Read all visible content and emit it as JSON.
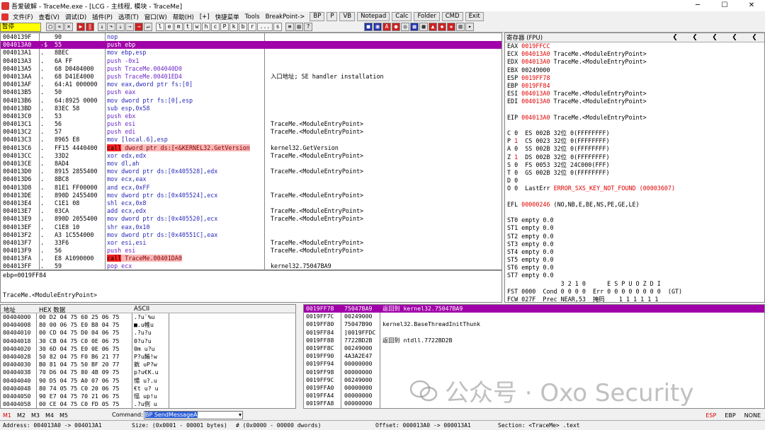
{
  "window": {
    "title": "吾爱破解 - TraceMe.exe - [LCG - 主线程, 模块 - TraceMe]"
  },
  "menu": {
    "items": [
      "文件(F)",
      "查看(V)",
      "调试(D)",
      "插件(P)",
      "选项(T)",
      "窗口(W)",
      "帮助(H)",
      "[+]",
      "快捷菜单",
      "Tools",
      "BreakPoint->"
    ],
    "buttons": [
      "BP",
      "P",
      "VB",
      "Notepad",
      "Calc",
      "Folder",
      "CMD",
      "Exit"
    ]
  },
  "toolbar": {
    "status": "暂停",
    "letters": [
      "l",
      "e",
      "m",
      "t",
      "w",
      "h",
      "c",
      "P",
      "k",
      "b",
      "r",
      "...",
      "s"
    ]
  },
  "cpu": {
    "rows": [
      {
        "addr": "0040139F",
        "mark": "",
        "hex": "90",
        "asm": "nop",
        "mn": "def",
        "cmt": ""
      },
      {
        "addr": "004013A0",
        "mark": "-$",
        "hex": "55",
        "asm": "push ebp",
        "mn": "push",
        "cmt": "",
        "sel": true
      },
      {
        "addr": "004013A1",
        "mark": ".",
        "hex": "8BEC",
        "asm": "mov ebp,esp",
        "mn": "def",
        "cmt": ""
      },
      {
        "addr": "004013A3",
        "mark": ".",
        "hex": "6A FF",
        "asm": "push -0x1",
        "mn": "push",
        "cmt": ""
      },
      {
        "addr": "004013A5",
        "mark": ".",
        "hex": "68 D0404000",
        "asm": "push TraceMe.004040D0",
        "mn": "push",
        "cmt": ""
      },
      {
        "addr": "004013AA",
        "mark": ".",
        "hex": "68 D41E4000",
        "asm": "push TraceMe.00401ED4",
        "mn": "push",
        "cmt": "入口地址; SE handler installation"
      },
      {
        "addr": "004013AF",
        "mark": ".",
        "hex": "64:A1 000000",
        "asm": "mov eax,dword ptr fs:[0]",
        "mn": "def",
        "cmt": ""
      },
      {
        "addr": "004013B5",
        "mark": ".",
        "hex": "50",
        "asm": "push eax",
        "mn": "push",
        "cmt": ""
      },
      {
        "addr": "004013B6",
        "mark": ".",
        "hex": "64:8925 0000",
        "asm": "mov dword ptr fs:[0],esp",
        "mn": "def",
        "cmt": ""
      },
      {
        "addr": "004013BD",
        "mark": ".",
        "hex": "83EC 58",
        "asm": "sub esp,0x58",
        "mn": "def",
        "cmt": ""
      },
      {
        "addr": "004013C0",
        "mark": ".",
        "hex": "53",
        "asm": "push ebx",
        "mn": "push",
        "cmt": ""
      },
      {
        "addr": "004013C1",
        "mark": ".",
        "hex": "56",
        "asm": "push esi",
        "mn": "push",
        "cmt": "TraceMe.<ModuleEntryPoint>"
      },
      {
        "addr": "004013C2",
        "mark": ".",
        "hex": "57",
        "asm": "push edi",
        "mn": "push",
        "cmt": "TraceMe.<ModuleEntryPoint>"
      },
      {
        "addr": "004013C3",
        "mark": ".",
        "hex": "8965 E8",
        "asm": "mov [local.6],esp",
        "mn": "def",
        "cmt": ""
      },
      {
        "addr": "004013C6",
        "mark": ".",
        "hex": "FF15 4440400",
        "asm": "call dword ptr ds:[<&KERNEL32.GetVersion",
        "mn": "call",
        "cmt": "kernel32.GetVersion"
      },
      {
        "addr": "004013CC",
        "mark": ".",
        "hex": "33D2",
        "asm": "xor edx,edx",
        "mn": "def",
        "cmt": "TraceMe.<ModuleEntryPoint>"
      },
      {
        "addr": "004013CE",
        "mark": ".",
        "hex": "8AD4",
        "asm": "mov dl,ah",
        "mn": "def",
        "cmt": ""
      },
      {
        "addr": "004013D0",
        "mark": ".",
        "hex": "8915 2855400",
        "asm": "mov dword ptr ds:[0x405528],edx",
        "mn": "def",
        "cmt": "TraceMe.<ModuleEntryPoint>"
      },
      {
        "addr": "004013D6",
        "mark": ".",
        "hex": "8BC8",
        "asm": "mov ecx,eax",
        "mn": "def",
        "cmt": ""
      },
      {
        "addr": "004013D8",
        "mark": ".",
        "hex": "81E1 FF00000",
        "asm": "and ecx,0xFF",
        "mn": "def",
        "cmt": ""
      },
      {
        "addr": "004013DE",
        "mark": ".",
        "hex": "890D 2455400",
        "asm": "mov dword ptr ds:[0x405524],ecx",
        "mn": "def",
        "cmt": "TraceMe.<ModuleEntryPoint>"
      },
      {
        "addr": "004013E4",
        "mark": ".",
        "hex": "C1E1 08",
        "asm": "shl ecx,0x8",
        "mn": "def",
        "cmt": ""
      },
      {
        "addr": "004013E7",
        "mark": ".",
        "hex": "03CA",
        "asm": "add ecx,edx",
        "mn": "def",
        "cmt": "TraceMe.<ModuleEntryPoint>"
      },
      {
        "addr": "004013E9",
        "mark": ".",
        "hex": "890D 2055400",
        "asm": "mov dword ptr ds:[0x405520],ecx",
        "mn": "def",
        "cmt": "TraceMe.<ModuleEntryPoint>"
      },
      {
        "addr": "004013EF",
        "mark": ".",
        "hex": "C1E8 10",
        "asm": "shr eax,0x10",
        "mn": "def",
        "cmt": ""
      },
      {
        "addr": "004013F2",
        "mark": ".",
        "hex": "A3 1C554000",
        "asm": "mov dword ptr ds:[0x40551C],eax",
        "mn": "def",
        "cmt": ""
      },
      {
        "addr": "004013F7",
        "mark": ".",
        "hex": "33F6",
        "asm": "xor esi,esi",
        "mn": "def",
        "cmt": "TraceMe.<ModuleEntryPoint>"
      },
      {
        "addr": "004013F9",
        "mark": ".",
        "hex": "56",
        "asm": "push esi",
        "mn": "push",
        "cmt": "TraceMe.<ModuleEntryPoint>"
      },
      {
        "addr": "004013FA",
        "mark": ".",
        "hex": "E8 A1090000",
        "asm": "call TraceMe.00401DA0",
        "mn": "call",
        "cmt": ""
      },
      {
        "addr": "004013FF",
        "mark": ".",
        "hex": "59",
        "asm": "pop ecx",
        "mn": "push",
        "cmt": "kernel32.75047BA9"
      }
    ]
  },
  "info": {
    "line1": "ebp=0019FF84",
    "line2": "TraceMe.<ModuleEntryPoint>"
  },
  "registers": {
    "header": "寄存器 (FPU)",
    "lines": [
      {
        "t": "EAX ",
        "v": "0019FFCC",
        "c": "",
        "red": true
      },
      {
        "t": "ECX ",
        "v": "004013A0",
        "c": " TraceMe.<ModuleEntryPoint>",
        "red": true
      },
      {
        "t": "EDX ",
        "v": "004013A0",
        "c": " TraceMe.<ModuleEntryPoint>",
        "red": true
      },
      {
        "t": "EBX ",
        "v": "00249000",
        "c": "",
        "red": false
      },
      {
        "t": "ESP ",
        "v": "0019FF78",
        "c": "",
        "red": true
      },
      {
        "t": "EBP ",
        "v": "0019FF84",
        "c": "",
        "red": true
      },
      {
        "t": "ESI ",
        "v": "004013A0",
        "c": " TraceMe.<ModuleEntryPoint>",
        "red": true
      },
      {
        "t": "EDI ",
        "v": "004013A0",
        "c": " TraceMe.<ModuleEntryPoint>",
        "red": true
      },
      {
        "t": "",
        "v": "",
        "c": "",
        "red": false
      },
      {
        "t": "EIP ",
        "v": "004013A0",
        "c": " TraceMe.<ModuleEntryPoint>",
        "red": true
      },
      {
        "t": "",
        "v": "",
        "c": "",
        "red": false
      },
      {
        "t": "C 0  ",
        "v": "",
        "c": "ES 002B 32位 0(FFFFFFFF)",
        "red": false
      },
      {
        "t": "P ",
        "v": "1",
        "c": "  CS 0023 32位 0(FFFFFFFF)",
        "red": true
      },
      {
        "t": "A 0  ",
        "v": "",
        "c": "SS 002B 32位 0(FFFFFFFF)",
        "red": false
      },
      {
        "t": "Z ",
        "v": "1",
        "c": "  DS 002B 32位 0(FFFFFFFF)",
        "red": true
      },
      {
        "t": "S 0  ",
        "v": "",
        "c": "FS 0053 32位 24C000(FFF)",
        "red": false
      },
      {
        "t": "T 0  ",
        "v": "",
        "c": "GS 002B 32位 0(FFFFFFFF)",
        "red": false
      },
      {
        "t": "D 0",
        "v": "",
        "c": "",
        "red": false
      },
      {
        "t": "O 0  LastErr ",
        "v": "ERROR_SXS_KEY_NOT_FOUND (00003607)",
        "c": "",
        "red": true
      },
      {
        "t": "",
        "v": "",
        "c": "",
        "red": false
      },
      {
        "t": "EFL ",
        "v": "00000246",
        "c": " (NO,NB,E,BE,NS,PE,GE,LE)",
        "red": true
      },
      {
        "t": "",
        "v": "",
        "c": "",
        "red": false
      },
      {
        "t": "ST0 empty 0.0",
        "v": "",
        "c": "",
        "red": false
      },
      {
        "t": "ST1 empty 0.0",
        "v": "",
        "c": "",
        "red": false
      },
      {
        "t": "ST2 empty 0.0",
        "v": "",
        "c": "",
        "red": false
      },
      {
        "t": "ST3 empty 0.0",
        "v": "",
        "c": "",
        "red": false
      },
      {
        "t": "ST4 empty 0.0",
        "v": "",
        "c": "",
        "red": false
      },
      {
        "t": "ST5 empty 0.0",
        "v": "",
        "c": "",
        "red": false
      },
      {
        "t": "ST6 empty 0.0",
        "v": "",
        "c": "",
        "red": false
      },
      {
        "t": "ST7 empty 0.0",
        "v": "",
        "c": "",
        "red": false
      },
      {
        "t": "               3 2 1 0      E S P U O Z D I",
        "v": "",
        "c": "",
        "red": false
      },
      {
        "t": "FST 0000  Cond 0 0 0 0  Err 0 0 0 0 0 0 0 0  (GT)",
        "v": "",
        "c": "",
        "red": false
      },
      {
        "t": "FCW 027F  Prec NEAR,53  掩码    1 1 1 1 1 1",
        "v": "",
        "c": "",
        "red": false
      }
    ]
  },
  "dump": {
    "headers": [
      "地址",
      "HEX 数据",
      "ASCII"
    ],
    "rows": [
      {
        "addr": "00404000",
        "hex": "00 D2 04 75 60 25 06 75",
        "ascii": ".?u`%u"
      },
      {
        "addr": "00404008",
        "hex": "80 00 06 75 E0 B8 04 75",
        "ascii": "■.u帷u"
      },
      {
        "addr": "00404010",
        "hex": "00 CD 04 75 D0 04 06 75",
        "ascii": ".?u?u"
      },
      {
        "addr": "00404018",
        "hex": "30 CB 04 75 C0 0E 06 75",
        "ascii": "0?u?u"
      },
      {
        "addr": "00404020",
        "hex": "30 6D 04 75 E0 0E 06 75",
        "ascii": "0m u?u"
      },
      {
        "addr": "00404028",
        "hex": "50 82 04 75 F0 B6 21 77",
        "ascii": "P?u餚!w"
      },
      {
        "addr": "00404030",
        "hex": "B0 81 04 75 50 BF 20 77",
        "ascii": "皝 uP?w"
      },
      {
        "addr": "00404038",
        "hex": "70 D6 04 75 80 4B 09 75",
        "ascii": "p?u€K.u"
      },
      {
        "addr": "00404040",
        "hex": "90 D5 04 75 A0 07 06 75",
        "ascii": "愓 u?.u"
      },
      {
        "addr": "00404048",
        "hex": "80 74 05 75 C0 20 06 75",
        "ascii": "€t u? u"
      },
      {
        "addr": "00404050",
        "hex": "90 E7 04 75 70 21 06 75",
        "ascii": "愮 up!u"
      },
      {
        "addr": "00404058",
        "hex": "00 CE 04 75 C0 FD 05 75",
        "ascii": ".?u例 u"
      }
    ]
  },
  "stack": {
    "rows": [
      {
        "addr": "0019FF78",
        "val": "75047BA9",
        "cmt": "返回到 kernel32.75047BA9",
        "sel": true
      },
      {
        "addr": "0019FF7C",
        "val": "00249000",
        "cmt": "",
        "sel": false
      },
      {
        "addr": "0019FF80",
        "val": "75047B90",
        "cmt": "kernel32.BaseThreadInitThunk",
        "sel": false
      },
      {
        "addr": "0019FF84",
        "val": "]0019FFDC",
        "cmt": "",
        "sel": false
      },
      {
        "addr": "0019FF88",
        "val": "7722BD2B",
        "cmt": "返回到 ntdll.7722BD2B",
        "sel": false
      },
      {
        "addr": "0019FF8C",
        "val": "00249000",
        "cmt": "",
        "sel": false
      },
      {
        "addr": "0019FF90",
        "val": "4A3A2E47",
        "cmt": "",
        "sel": false
      },
      {
        "addr": "0019FF94",
        "val": "00000000",
        "cmt": "",
        "sel": false
      },
      {
        "addr": "0019FF98",
        "val": "00000000",
        "cmt": "",
        "sel": false
      },
      {
        "addr": "0019FF9C",
        "val": "00249000",
        "cmt": "",
        "sel": false
      },
      {
        "addr": "0019FFA0",
        "val": "00000000",
        "cmt": "",
        "sel": false
      },
      {
        "addr": "0019FFA4",
        "val": "00000000",
        "cmt": "",
        "sel": false
      },
      {
        "addr": "0019FFA8",
        "val": "00000000",
        "cmt": "",
        "sel": false
      }
    ]
  },
  "cmdbar": {
    "tabs": [
      "M1",
      "M2",
      "M3",
      "M4",
      "M5"
    ],
    "label": "Command:",
    "value": "BP SendMessageA",
    "regtabs": [
      "ESP",
      "EBP",
      "NONE"
    ]
  },
  "status": {
    "address": "Address: 004013A0 -> 004013A1",
    "size": "Size: (0x0001 - 00001 bytes)",
    "dwords": "#   (0x0000 - 00000 dwords)",
    "offset": "Offset: 000013A0 -> 000013A1",
    "section": "Section: <TraceMe> .text"
  },
  "watermark": {
    "text": "公众号 · Oxo Security"
  }
}
